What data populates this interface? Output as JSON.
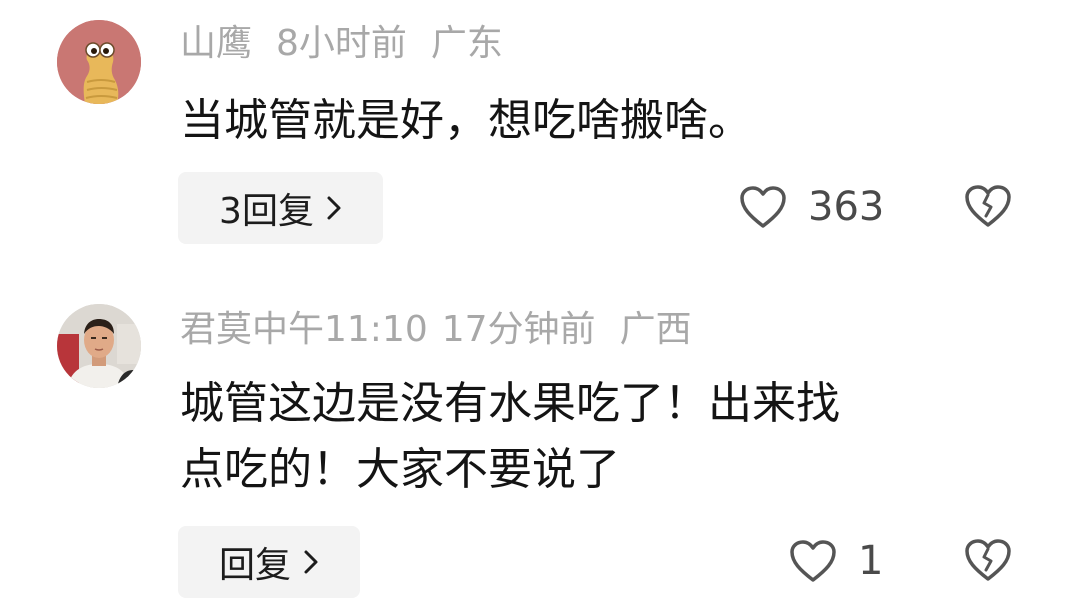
{
  "comments": [
    {
      "username": "山鹰",
      "time": "8小时前",
      "location": "广东",
      "text": "当城管就是好，想吃啥搬啥。",
      "reply_label": "3回复",
      "like_count": "363",
      "avatar_icon": "cartoon-worm-avatar",
      "avatar_bg": "#c97773"
    },
    {
      "username": "君莫中午11:10",
      "time": "17分钟前",
      "location": "广西",
      "text": "城管这边是没有水果吃了！出来找\n点吃的！大家不要说了",
      "reply_label": "回复",
      "like_count": "1",
      "avatar_icon": "man-photo-avatar",
      "avatar_bg": "#d8d4cf"
    }
  ],
  "icons": {
    "like": "heart-outline-icon",
    "dislike": "broken-heart-outline-icon",
    "chevron": "chevron-right-icon"
  },
  "colors": {
    "meta_gray": "#a8a8a8",
    "text_dark": "#141414",
    "button_bg": "#f3f3f3",
    "icon_gray": "#555555"
  }
}
